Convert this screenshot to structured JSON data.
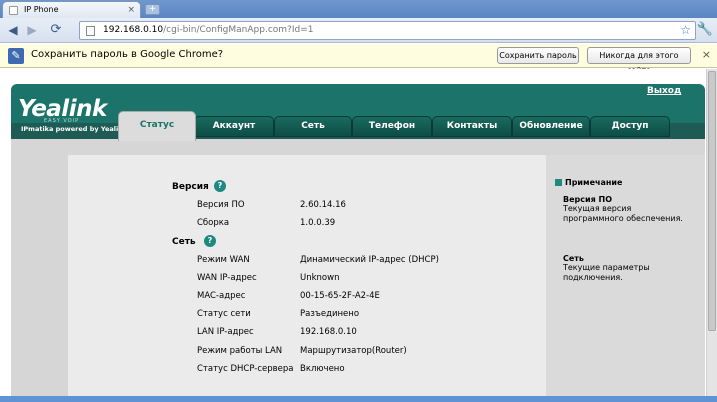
{
  "browser": {
    "tab_title": "IP Phone",
    "new_tab_label": "+",
    "address_host": "192.168.0.10",
    "address_path": "/cgi-bin/ConfigManApp.com?Id=1"
  },
  "password_bar": {
    "message": "Сохранить пароль в Google Chrome?",
    "save_label": "Сохранить пароль",
    "never_label": "Никогда для этого сайта"
  },
  "app": {
    "logo": "Yealink",
    "logo_sub": "EASY VOIP",
    "tagline": "IPmatika powered by Yealink",
    "logout": "Выход"
  },
  "nav": {
    "status": "Статус",
    "account": "Аккаунт",
    "network": "Сеть",
    "phone": "Телефон",
    "contacts": "Контакты",
    "update": "Обновление",
    "access": "Доступ"
  },
  "version": {
    "title": "Версия",
    "fw_label": "Версия ПО",
    "fw_value": "2.60.14.16",
    "build_label": "Сборка",
    "build_value": "1.0.0.39"
  },
  "network": {
    "title": "Сеть",
    "rows": [
      {
        "label": "Режим WAN",
        "value": "Динамический IP-адрес (DHCP)"
      },
      {
        "label": "WAN IP-адрес",
        "value": "Unknown"
      },
      {
        "label": "MAC-адрес",
        "value": "00-15-65-2F-A2-4E"
      },
      {
        "label": "Статус сети",
        "value": "Разъединено"
      },
      {
        "label": "LAN IP-адрес",
        "value": "192.168.0.10"
      },
      {
        "label": "Режим работы LAN",
        "value": "Маршрутизатор(Router)"
      },
      {
        "label": "Статус DHCP-сервера",
        "value": "Включено"
      }
    ]
  },
  "note": {
    "header": "Примечание",
    "fw_title": "Версия ПО",
    "fw_text": "Текущая версия программного обеспечения.",
    "net_title": "Сеть",
    "net_text": "Текущие параметры подключения."
  },
  "help_glyph": "?",
  "colors": {
    "accent": "#1b7369",
    "tab_dark": "#0e4d45"
  }
}
